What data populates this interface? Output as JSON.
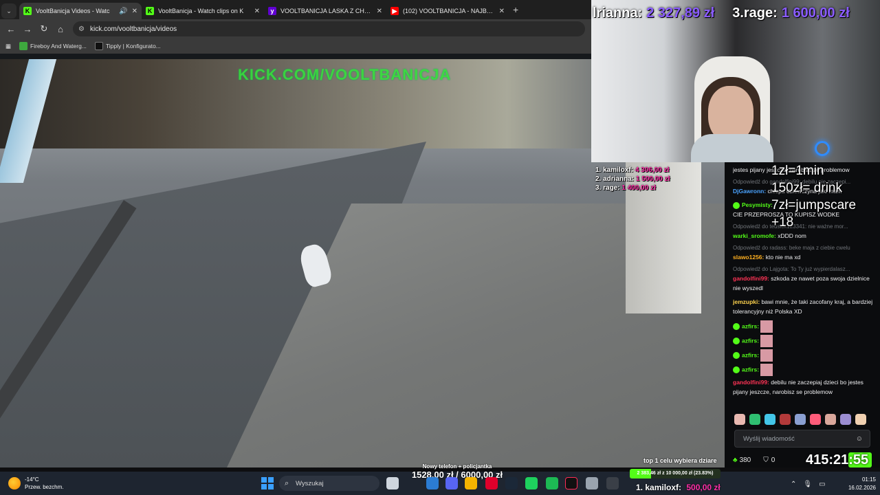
{
  "browser": {
    "tabs": [
      {
        "title": "VooltBanicja Videos - Watc",
        "favicon": "kick",
        "active": true
      },
      {
        "title": "VooltBanicja - Watch clips on K",
        "favicon": "kick",
        "active": false
      },
      {
        "title": "VOOLTBANICJA LASKA Z CHŁO",
        "favicon": "yahoo",
        "active": false
      },
      {
        "title": "(102) VOOLTBANICJA - NAJBAR",
        "favicon": "youtube",
        "active": false
      }
    ],
    "url": "kick.com/vooltbanicja/videos",
    "bookmarks": [
      {
        "label": "Fireboy And Waterg..."
      },
      {
        "label": "Tipply | Konfigurato..."
      }
    ]
  },
  "stream": {
    "watermark": "KICK.COM/VOOLTBANICJA",
    "top_overlay": [
      {
        "name": "lrianna:",
        "amount": "2 327,89 zł"
      },
      {
        "name": "3.rage:",
        "amount": "1 600,00 zł"
      }
    ],
    "top_donors": [
      {
        "name": "1. kamiloxf:",
        "value": "4 306,00 zł"
      },
      {
        "name": "2. adrianna:",
        "value": "1 500,00 zł"
      },
      {
        "name": "3. rage:",
        "value": "1 400,00 zł"
      }
    ],
    "rules": [
      "1zł=1min",
      "150zł= drink",
      "7zł=jumpscare",
      "+18"
    ],
    "goal_label": "top 1 celu wybiera dziare",
    "phone_goal": {
      "label": "Nowy telefon + policjantka",
      "value": "1528,00 zł / 6000,00 zł"
    },
    "goal_bar": {
      "text": "2 383,46 zł z 10 000,00 zł (23.83%)",
      "progress": 0.2383
    },
    "top_donor_bar": {
      "name": "1. kamiloxf:",
      "value": "500,00 zł"
    },
    "counter": "415:21:55"
  },
  "chat": {
    "messages": [
      {
        "type": "text",
        "user": "",
        "text": "jestes pijany jeszcze, narobisz ze problemow",
        "color": "#efeff1"
      },
      {
        "type": "reply",
        "text": "Odpowiedź do gandolfini99: debilu nie zaczepi..."
      },
      {
        "type": "text",
        "user": "DjGawronn:",
        "text": "chlopa dziewczyna jaki mam",
        "color": "#4aa3ff"
      },
      {
        "type": "text",
        "user": "Pesymisty:",
        "text": "CIE PRZEPROSZA TO KUPISZ WODKE",
        "color": "#53fc18"
      },
      {
        "type": "reply",
        "text": "Odpowiedź do teusick123341: nie ważne mor..."
      },
      {
        "type": "text",
        "user": "warki_sromofe:",
        "text": "xDDD nom",
        "color": "#53fc18"
      },
      {
        "type": "reply",
        "text": "Odpowiedź do radass: beke maja z ciebie cwelu"
      },
      {
        "type": "text",
        "user": "slawo1256:",
        "text": "kto nie ma xd",
        "color": "#ffb020"
      },
      {
        "type": "reply",
        "text": "Odpowiedź do Lajgota: To Ty już wypierdalasz..."
      },
      {
        "type": "text",
        "user": "gandolfini99:",
        "text": "szkoda ze nawet poza swoja dzielnice nie wyszedl",
        "color": "#ff3355"
      },
      {
        "type": "text",
        "user": "jemzupki:",
        "text": "bawi mnie, że taki zacofany kraj, a bardziej tolerancyjny niż Polska XD",
        "color": "#ffd34d"
      },
      {
        "type": "emote",
        "user": "azfirs:",
        "color": "#53fc18"
      },
      {
        "type": "emote",
        "user": "azfirs:",
        "color": "#53fc18"
      },
      {
        "type": "emote",
        "user": "azfirs:",
        "color": "#53fc18"
      },
      {
        "type": "emote",
        "user": "azfirs:",
        "color": "#53fc18"
      },
      {
        "type": "text",
        "user": "gandolfini99:",
        "text": "debilu nie zaczepiaj dzieci bo jestes pijany jeszcze, narobisz se problemow",
        "color": "#ff3355"
      }
    ],
    "input_placeholder": "Wyślij wiadomość",
    "viewers": "380",
    "subs": "0"
  },
  "taskbar": {
    "weather_temp": "-14°C",
    "weather_desc": "Przew. bezchm.",
    "search": "Wyszukaj",
    "time": "01:15",
    "date": "16.02.2026"
  }
}
